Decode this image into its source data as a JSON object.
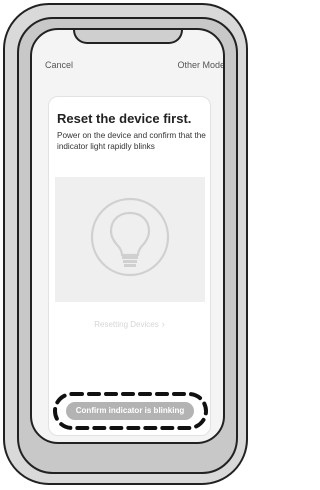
{
  "header": {
    "cancel_label": "Cancel",
    "other_mode_label": "Other Mode"
  },
  "card": {
    "title": "Reset the device first.",
    "description": "Power on the device and confirm that the indicator light rapidly blinks",
    "illustration_icon": "lightbulb-icon",
    "resetting_link_label": "Resetting Devices",
    "resetting_link_icon": "chevron-right-icon",
    "confirm_button_label": "Confirm indicator is blinking"
  },
  "colors": {
    "frame_stroke": "#222222",
    "screen_background": "#f4f4f4",
    "card_background": "#ffffff",
    "image_placeholder": "#efefef",
    "button_fill": "#b3b3b3",
    "link_text": "#d6d6d6"
  }
}
